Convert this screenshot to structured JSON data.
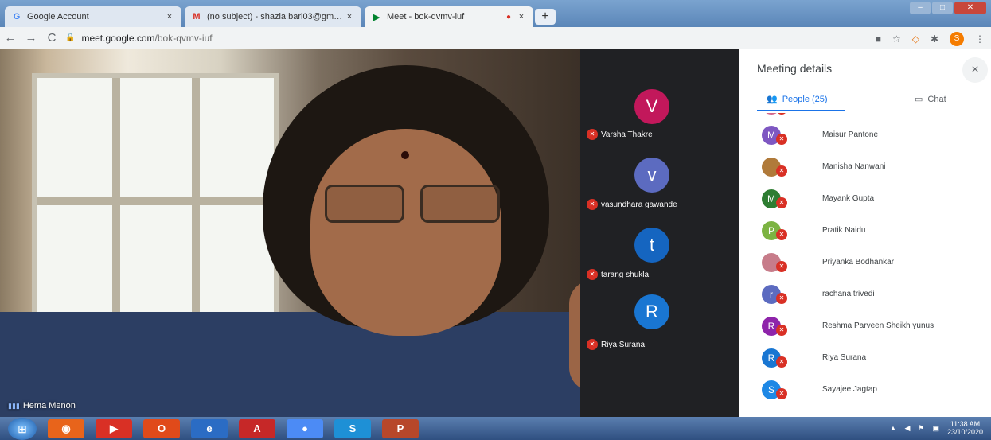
{
  "browser": {
    "tabs": [
      {
        "label": "Google Account",
        "icon": "google-g-icon",
        "close": "×"
      },
      {
        "label": "(no subject) - shazia.bari03@gm…",
        "icon": "gmail-icon",
        "close": "×"
      },
      {
        "label": "Meet - bok-qvmv-iuf",
        "icon": "meet-icon",
        "close": "×"
      }
    ],
    "new_tab": "+",
    "url_host": "meet.google.com",
    "url_path": "/bok-qvmv-iuf",
    "profile_initial": "S"
  },
  "video": {
    "speaker_name": "Hema Menon"
  },
  "tiles": [
    {
      "initial": "V",
      "name": "Varsha Thakre",
      "color": "#c2185b"
    },
    {
      "initial": "v",
      "name": "vasundhara gawande",
      "color": "#5c6bc0"
    },
    {
      "initial": "t",
      "name": "tarang shukla",
      "color": "#1565c0"
    },
    {
      "initial": "R",
      "name": "Riya Surana",
      "color": "#1976d2"
    }
  ],
  "panel": {
    "title": "Meeting details",
    "close": "×",
    "people_tab": "People (25)",
    "chat_tab": "Chat",
    "people": [
      {
        "initial": "M",
        "name": "Maisur Pantone",
        "color": "#7e57c2"
      },
      {
        "initial": "",
        "name": "Manisha Nanwani",
        "color": "#b07a3a"
      },
      {
        "initial": "M",
        "name": "Mayank Gupta",
        "color": "#2e7d32"
      },
      {
        "initial": "P",
        "name": "Pratik Naidu",
        "color": "#7cb342"
      },
      {
        "initial": "",
        "name": "Priyanka Bodhankar",
        "color": "#c77c8a"
      },
      {
        "initial": "r",
        "name": "rachana trivedi",
        "color": "#5c6bc0"
      },
      {
        "initial": "R",
        "name": "Reshma Parveen Sheikh yunus",
        "color": "#8e24aa"
      },
      {
        "initial": "R",
        "name": "Riya Surana",
        "color": "#1976d2"
      },
      {
        "initial": "S",
        "name": "Sayajee Jagtap",
        "color": "#1e88e5"
      }
    ]
  },
  "taskbar": {
    "time": "11:38 AM",
    "date": "23/10/2020"
  }
}
